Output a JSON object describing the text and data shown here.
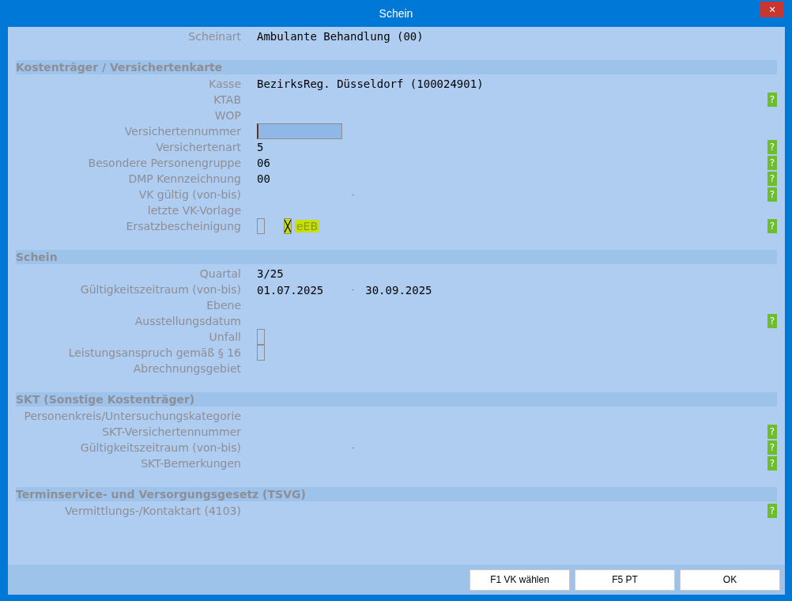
{
  "window": {
    "title": "Schein",
    "close": "✕"
  },
  "sections": [
    {
      "rows": [
        {
          "label": "Scheinart",
          "kind": "text",
          "value": "Ambulante Behandlung (00)"
        }
      ]
    },
    {
      "title": "Kostenträger / Versichertenkarte",
      "rows": [
        {
          "label": "Kasse",
          "kind": "text",
          "value": "BezirksReg. Düsseldorf (100024901)"
        },
        {
          "label": "KTAB",
          "kind": "text",
          "help": "?"
        },
        {
          "label": "WOP",
          "kind": "text"
        },
        {
          "label": "Versichertennummer",
          "kind": "input"
        },
        {
          "label": "Versichertenart",
          "kind": "text",
          "value": "5",
          "help": "?"
        },
        {
          "label": "Besondere Personengruppe",
          "kind": "text",
          "value": "06",
          "help": "?"
        },
        {
          "label": "DMP Kennzeichnung",
          "kind": "text",
          "value": "00",
          "help": "?"
        },
        {
          "label": "VK gültig (von-bis)",
          "kind": "range",
          "separator": "-",
          "help": "?"
        },
        {
          "label": "letzte VK-Vorlage",
          "kind": "text"
        },
        {
          "label": "Ersatzbescheinigung",
          "kind": "checks",
          "boxes": [
            {
              "checked": false
            },
            {
              "checked": true
            }
          ],
          "note": "eEB",
          "help": "?"
        }
      ]
    },
    {
      "title": "Schein",
      "rows": [
        {
          "label": "Quartal",
          "kind": "text",
          "value": "3/25"
        },
        {
          "label": "Gültigkeitszeitraum (von-bis)",
          "kind": "range",
          "from": "01.07.2025",
          "separator": "-",
          "to": "30.09.2025"
        },
        {
          "label": "Ebene",
          "kind": "text"
        },
        {
          "label": "Ausstellungsdatum",
          "kind": "text",
          "help": "?"
        },
        {
          "label": "Unfall",
          "kind": "checkbox",
          "checked": false
        },
        {
          "label": "Leistungsanspruch gemäß § 16",
          "kind": "checkbox",
          "checked": false
        },
        {
          "label": "Abrechnungsgebiet",
          "kind": "text"
        }
      ]
    },
    {
      "title": "SKT (Sonstige Kostenträger)",
      "rows": [
        {
          "label": "Personenkreis/Untersuchungskategorie",
          "kind": "text"
        },
        {
          "label": "SKT-Versichertennummer",
          "kind": "text",
          "help": "?"
        },
        {
          "label": "Gültigkeitszeitraum (von-bis)",
          "kind": "range",
          "separator": "-",
          "help": "?"
        },
        {
          "label": "SKT-Bemerkungen",
          "kind": "text",
          "help": "?"
        }
      ]
    },
    {
      "title": "Terminservice- und Versorgungsgesetz (TSVG)",
      "rows": [
        {
          "label": "Vermittlungs-/Kontaktart (4103)",
          "kind": "text",
          "help": "?"
        }
      ]
    }
  ],
  "buttons": [
    "F1 VK wählen",
    "F5 PT",
    "OK"
  ]
}
